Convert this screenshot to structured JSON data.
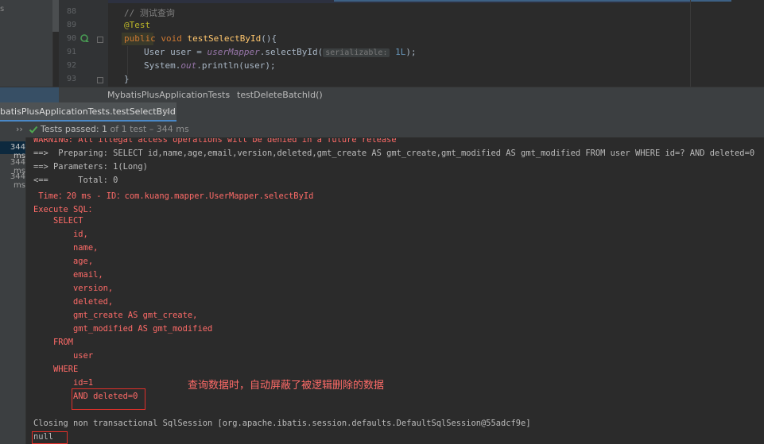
{
  "sidebar": {
    "label": "s"
  },
  "editor": {
    "line_numbers": [
      "88",
      "89",
      "90",
      "91",
      "92",
      "93"
    ],
    "lines": {
      "l88": "// 测试查询",
      "l89": "@Test",
      "l90_kw1": "public",
      "l90_kw2": "void",
      "l90_fn": "testSelectById",
      "l90_rest": "(){",
      "l91_pre": "User user = ",
      "l91_field": "userMapper",
      "l91_mid": ".selectById(",
      "l91_hint": "serializable:",
      "l91_num": "1L",
      "l91_end": ");",
      "l92_pre": "System.",
      "l92_field": "out",
      "l92_end": ".println(user);",
      "l93": "}"
    }
  },
  "breadcrumb": {
    "class_name": "MybatisPlusApplicationTests",
    "separator": "›",
    "method_name": "testDeleteBatchId()"
  },
  "run_panel": {
    "tab_label": "batisPlusApplicationTests.testSelectById",
    "tab_close": "×"
  },
  "test_status": {
    "chevron": "››",
    "passed_label": "Tests passed: ",
    "passed_count": "1",
    "passed_rest": " of 1 test – 344 ms",
    "tree_times": [
      "344 ms",
      "344 ms",
      "344 ms"
    ]
  },
  "console": {
    "warning": "WARNING: All illegal access operations will be denied in a future release",
    "preparing": "==>  Preparing: SELECT id,name,age,email,version,deleted,gmt_create AS gmt_create,gmt_modified AS gmt_modified FROM user WHERE id=? AND deleted=0",
    "parameters": "==> Parameters: 1(Long)",
    "total": "<==      Total: 0",
    "time": " Time：20 ms - ID：com.kuang.mapper.UserMapper.selectById",
    "execute_sql": "Execute SQL：",
    "sql_lines": [
      "    SELECT",
      "        id,",
      "        name,",
      "        age,",
      "        email,",
      "        version,",
      "        deleted,",
      "        gmt_create AS gmt_create,",
      "        gmt_modified AS gmt_modified",
      "    FROM",
      "        user",
      "    WHERE",
      "        id=1",
      "        AND deleted=0"
    ],
    "closing": "Closing non transactional SqlSession [org.apache.ibatis.session.defaults.DefaultSqlSession@55adcf9e]",
    "result": "null",
    "annotation_note": "查询数据时，自动屏蔽了被逻辑删除的数据"
  },
  "colors": {
    "console_error": "#ff6b68",
    "console_text": "#bbbbbb",
    "highlight_box": "#e0302a",
    "pass_green": "#4fa650"
  }
}
